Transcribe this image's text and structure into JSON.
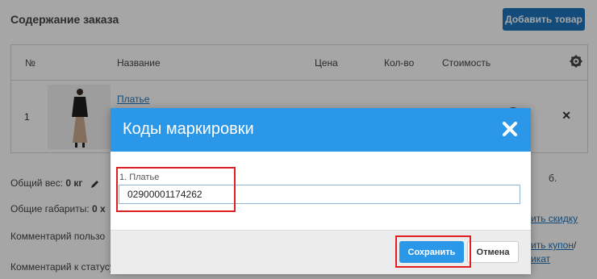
{
  "order": {
    "section_title": "Содержание заказа",
    "add_button": "Добавить товар",
    "columns": [
      "№",
      "Название",
      "Цена",
      "Кол-во",
      "Стоимость"
    ],
    "row": {
      "num": "1",
      "product_link": "Платье"
    },
    "total_weight_label": "Общий вес:",
    "total_weight_value": "0 кг",
    "total_dims_label": "Общие габариты:",
    "total_dims_value": "0 х",
    "comment_user_label": "Комментарий пользо",
    "comment_status_label": "Комментарий к статусу",
    "right_fragment_1": "б.",
    "right_link_discount": "ить скидку",
    "right_link_coupon": "ить купон",
    "right_link_slash": "/",
    "right_link_cert": "икат"
  },
  "modal": {
    "title": "Коды маркировки",
    "field_label": "1. Платье",
    "field_value": "02900001174262",
    "save_label": "Сохранить",
    "cancel_label": "Отмена"
  },
  "colors": {
    "accent": "#2b97e8",
    "highlight": "#e02020",
    "dark_button": "#1e74bd"
  }
}
